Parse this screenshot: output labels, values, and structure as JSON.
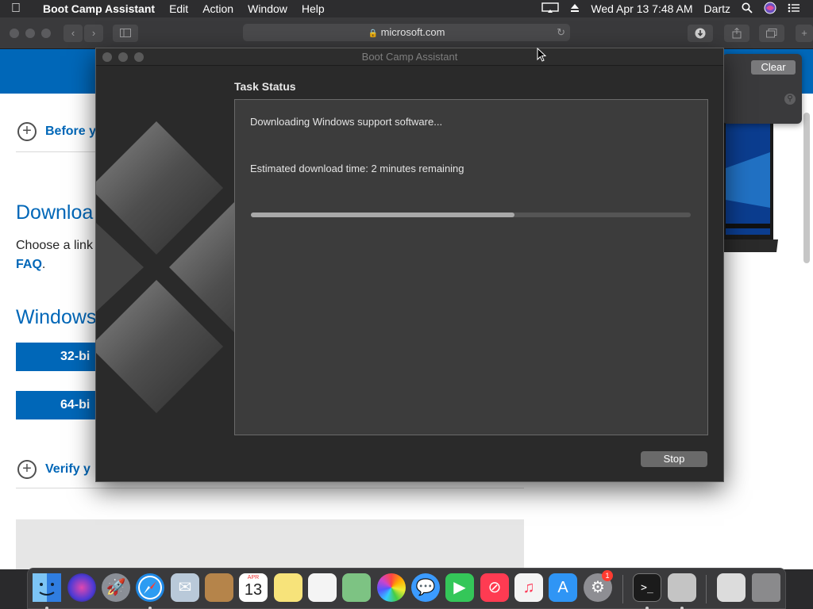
{
  "menubar": {
    "app_name": "Boot Camp Assistant",
    "menus": [
      "Edit",
      "Action",
      "Window",
      "Help"
    ],
    "datetime": "Wed Apr 13  7:48 AM",
    "user": "Dartz"
  },
  "safari": {
    "address": "microsoft.com"
  },
  "webpage": {
    "section1": "Before y",
    "heading_download": "Downloa",
    "choose_text": "Choose a link",
    "faq": "FAQ",
    "faq_after": ".",
    "heading_windows": "Windows",
    "btn_32": "32-bi",
    "btn_64": "64-bi",
    "section_verify": "Verify y"
  },
  "popover": {
    "clear_label": "Clear"
  },
  "bootcamp": {
    "title": "Boot Camp Assistant",
    "task_status_label": "Task Status",
    "status_line": "Downloading Windows support software...",
    "eta_line": "Estimated download time: 2 minutes remaining",
    "progress": 0.6,
    "stop_label": "Stop"
  },
  "dock": {
    "calendar_month": "APR",
    "calendar_day": "13",
    "system_prefs_badge": "1",
    "icons": [
      "finder-icon",
      "siri-icon",
      "launchpad-icon",
      "safari-icon",
      "mail-icon",
      "contacts-icon",
      "calendar-icon",
      "notes-icon",
      "reminders-icon",
      "maps-icon",
      "photos-icon",
      "messages-icon",
      "facetime-icon",
      "news-icon",
      "music-icon",
      "app-store-icon",
      "system-preferences-icon",
      "terminal-icon",
      "disk-utility-icon",
      "downloads-stack-icon",
      "trash-icon"
    ]
  },
  "colors": {
    "ms_blue": "#0067b8",
    "window_bg": "#2a2a2a",
    "panel_bg": "#3c3c3c"
  }
}
